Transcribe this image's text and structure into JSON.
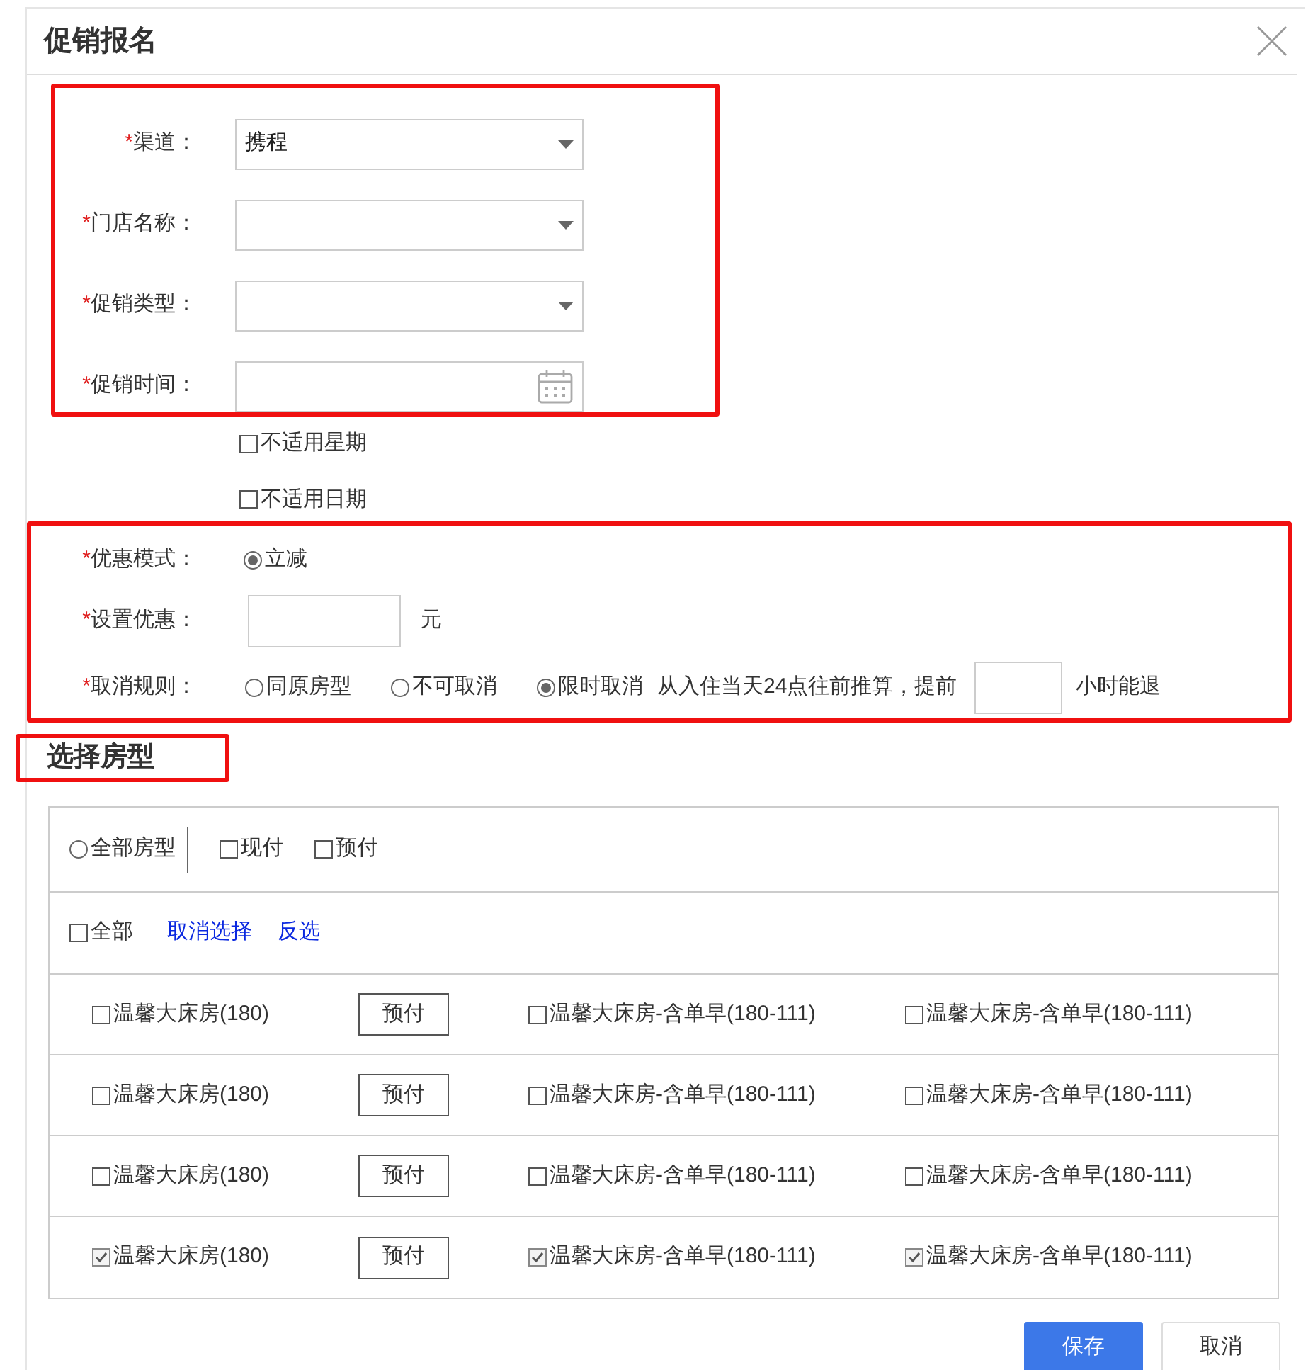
{
  "dialog": {
    "title": "促销报名"
  },
  "basic_section": {
    "highlighted": true,
    "fields": [
      {
        "marker": "*",
        "label": "渠道：",
        "kind": "select",
        "value": "携程"
      },
      {
        "marker": "*",
        "label": "门店名称：",
        "kind": "select"
      },
      {
        "marker": "*",
        "label": "促销类型：",
        "kind": "select"
      },
      {
        "marker": "*",
        "label": "促销时间：",
        "kind": "date"
      }
    ]
  },
  "exclusions": [
    {
      "label": "不适用星期",
      "checked": false
    },
    {
      "label": "不适用日期",
      "checked": false
    }
  ],
  "discount_section": {
    "highlighted": true,
    "mode": {
      "marker": "*",
      "label": "优惠模式：",
      "options": [
        {
          "label": "立减",
          "selected": true
        }
      ]
    },
    "amount": {
      "marker": "*",
      "label": "设置优惠：",
      "unit": "元"
    },
    "cancel": {
      "marker": "*",
      "label": "取消规则：",
      "options": [
        {
          "label": "同原房型",
          "selected": false
        },
        {
          "label": "不可取消",
          "selected": false
        },
        {
          "label": "限时取消",
          "selected": true
        }
      ],
      "note": "从入住当天24点往前推算，提前",
      "suffix": "小时能退"
    }
  },
  "room_section": {
    "title": "选择房型",
    "highlighted": true,
    "all_types": {
      "label": "全部房型",
      "selected": false
    },
    "payment_types": [
      {
        "label": "现付",
        "checked": false
      },
      {
        "label": "预付",
        "checked": false
      }
    ],
    "select_all": {
      "label": "全部",
      "checked": false
    },
    "links": [
      "取消选择",
      "反选"
    ],
    "rows": [
      {
        "room": {
          "label": "温馨大床房(180)",
          "checked": false
        },
        "payment": "预付",
        "rates": [
          {
            "label": "温馨大床房-含单早(180-111)",
            "checked": false
          },
          {
            "label": "温馨大床房-含单早(180-111)",
            "checked": false
          }
        ]
      },
      {
        "room": {
          "label": "温馨大床房(180)",
          "checked": false
        },
        "payment": "预付",
        "rates": [
          {
            "label": "温馨大床房-含单早(180-111)",
            "checked": false
          },
          {
            "label": "温馨大床房-含单早(180-111)",
            "checked": false
          }
        ]
      },
      {
        "room": {
          "label": "温馨大床房(180)",
          "checked": false
        },
        "payment": "预付",
        "rates": [
          {
            "label": "温馨大床房-含单早(180-111)",
            "checked": false
          },
          {
            "label": "温馨大床房-含单早(180-111)",
            "checked": false
          }
        ]
      },
      {
        "room": {
          "label": "温馨大床房(180)",
          "checked": true
        },
        "payment": "预付",
        "rates": [
          {
            "label": "温馨大床房-含单早(180-111)",
            "checked": true
          },
          {
            "label": "温馨大床房-含单早(180-111)",
            "checked": true
          }
        ]
      }
    ]
  },
  "buttons": [
    {
      "label": "保存",
      "kind": "primary"
    },
    {
      "label": "取消",
      "kind": "default"
    }
  ]
}
